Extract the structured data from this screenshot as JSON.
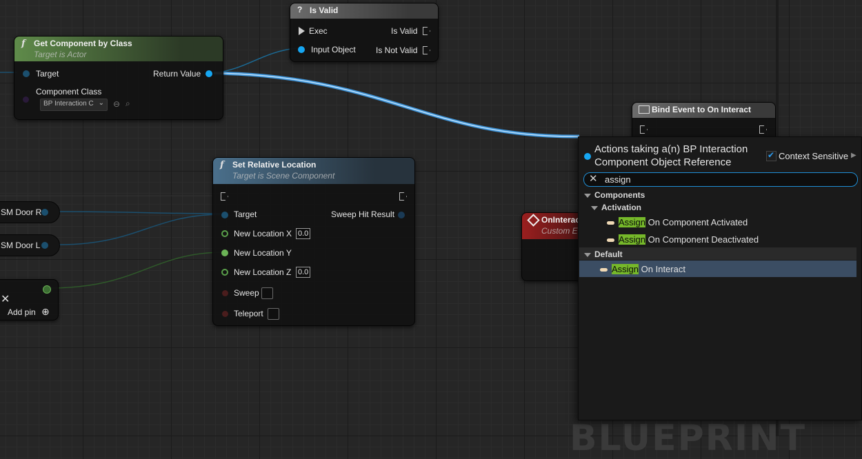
{
  "nodes": {
    "get_component": {
      "title": "Get Component by Class",
      "subtitle": "Target is Actor",
      "pin_target": "Target",
      "pin_return": "Return Value",
      "pin_component_class": "Component Class",
      "class_value": "BP Interaction C"
    },
    "is_valid": {
      "title": "Is Valid",
      "pin_exec": "Exec",
      "pin_input": "Input Object",
      "out_valid": "Is Valid",
      "out_not_valid": "Is Not Valid"
    },
    "bind_event": {
      "title": "Bind Event to On Interact"
    },
    "set_location": {
      "title": "Set Relative Location",
      "subtitle": "Target is Scene Component",
      "pin_target": "Target",
      "pin_sweep_hit": "Sweep Hit Result",
      "pin_x": "New Location X",
      "val_x": "0.0",
      "pin_y": "New Location Y",
      "pin_z": "New Location Z",
      "val_z": "0.0",
      "pin_sweep": "Sweep",
      "pin_teleport": "Teleport"
    },
    "custom_event": {
      "title": "OnInterac",
      "subtitle": "Custom E"
    },
    "reroute": {
      "door_r": "SM Door R",
      "door_l": "SM Door L",
      "add_pin": "Add pin"
    }
  },
  "menu": {
    "title_line1": "Actions taking a(n) BP Interaction",
    "title_line2": "Component Object Reference",
    "context_sensitive": "Context Sensitive",
    "search_value": "assign",
    "categories": {
      "components": "Components",
      "activation": "Activation",
      "default": "Default"
    },
    "items": [
      {
        "highlight": "Assign",
        "rest": " On Component Activated"
      },
      {
        "highlight": "Assign",
        "rest": " On Component Deactivated"
      },
      {
        "highlight": "Assign",
        "rest": " On Interact"
      }
    ]
  },
  "watermark": "BLUEPRINT",
  "colors": {
    "object_pin": "#16a6f2",
    "float_pin": "#6bb356",
    "search_focus": "#1f8fd6",
    "selection": "#3b4d63",
    "highlight": "#76b82a"
  }
}
